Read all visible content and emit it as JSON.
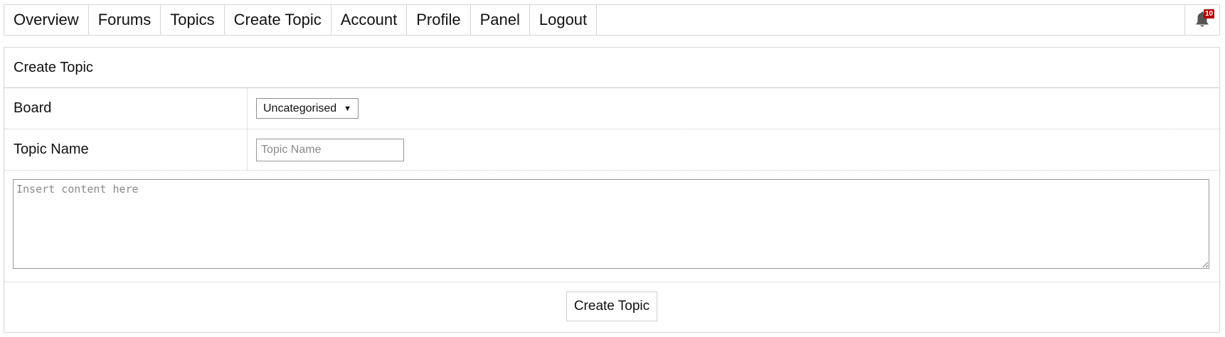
{
  "nav": {
    "items": [
      {
        "label": "Overview"
      },
      {
        "label": "Forums"
      },
      {
        "label": "Topics"
      },
      {
        "label": "Create Topic"
      },
      {
        "label": "Account"
      },
      {
        "label": "Profile"
      },
      {
        "label": "Panel"
      },
      {
        "label": "Logout"
      }
    ],
    "alerts": {
      "icon": "bell-icon",
      "count": "10",
      "badge_color": "#b30000"
    }
  },
  "panel": {
    "title": "Create Topic",
    "board": {
      "label": "Board",
      "selected": "Uncategorised"
    },
    "topic_name": {
      "label": "Topic Name",
      "value": "",
      "placeholder": "Topic Name"
    },
    "content": {
      "value": "",
      "placeholder": "Insert content here"
    },
    "submit_label": "Create Topic"
  }
}
